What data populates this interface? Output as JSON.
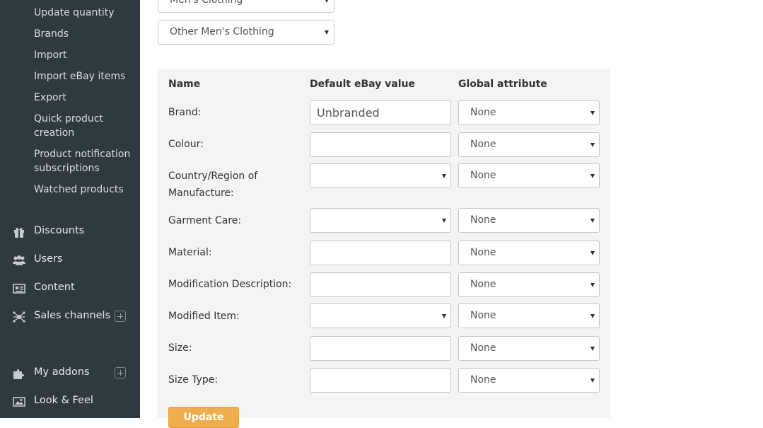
{
  "sidebar": {
    "sub_items": [
      {
        "label": "Update quantity"
      },
      {
        "label": "Brands"
      },
      {
        "label": "Import"
      },
      {
        "label": "Import eBay items"
      },
      {
        "label": "Export"
      },
      {
        "label": "Quick product creation",
        "line1": "Quick product",
        "line2": "creation"
      },
      {
        "label": "Product notification subscriptions",
        "line1": "Product notification",
        "line2": "subscriptions"
      },
      {
        "label": "Watched products"
      }
    ],
    "main_items": [
      {
        "label": "Discounts",
        "icon": "gift-icon"
      },
      {
        "label": "Users",
        "icon": "users-icon"
      },
      {
        "label": "Content",
        "icon": "newspaper-icon"
      },
      {
        "label": "Sales channels",
        "icon": "network-icon"
      },
      {
        "label": "My addons",
        "icon": "puzzle-icon"
      },
      {
        "label": "Look & Feel",
        "icon": "image-icon"
      }
    ]
  },
  "category": {
    "parent_select": "Men's Clothing",
    "child_select": "Other Men's Clothing"
  },
  "attributes": {
    "headers": {
      "name": "Name",
      "default_value": "Default eBay value",
      "global_attribute": "Global attribute"
    },
    "rows": [
      {
        "name": "Brand:",
        "default_value": "Unbranded",
        "field_type": "text",
        "global": "None"
      },
      {
        "name": "Colour:",
        "default_value": "",
        "field_type": "text",
        "global": "None"
      },
      {
        "name": "Country/Region of Manufacture:",
        "line1": "Country/Region of",
        "line2": "Manufacture:",
        "default_value": "",
        "field_type": "select",
        "global": "None"
      },
      {
        "name": "Garment Care:",
        "default_value": "",
        "field_type": "select",
        "global": "None"
      },
      {
        "name": "Material:",
        "default_value": "",
        "field_type": "text",
        "global": "None"
      },
      {
        "name": "Modification Description:",
        "default_value": "",
        "field_type": "text",
        "global": "None"
      },
      {
        "name": "Modified Item:",
        "default_value": "",
        "field_type": "select",
        "global": "None"
      },
      {
        "name": "Size:",
        "default_value": "",
        "field_type": "text",
        "global": "None"
      },
      {
        "name": "Size Type:",
        "default_value": "",
        "field_type": "text",
        "global": "None"
      }
    ],
    "update_label": "Update"
  },
  "colors": {
    "sidebar_bg": "#2f3a40",
    "panel_bg": "#f4f4f4",
    "button_bg": "#f0ad4e"
  }
}
